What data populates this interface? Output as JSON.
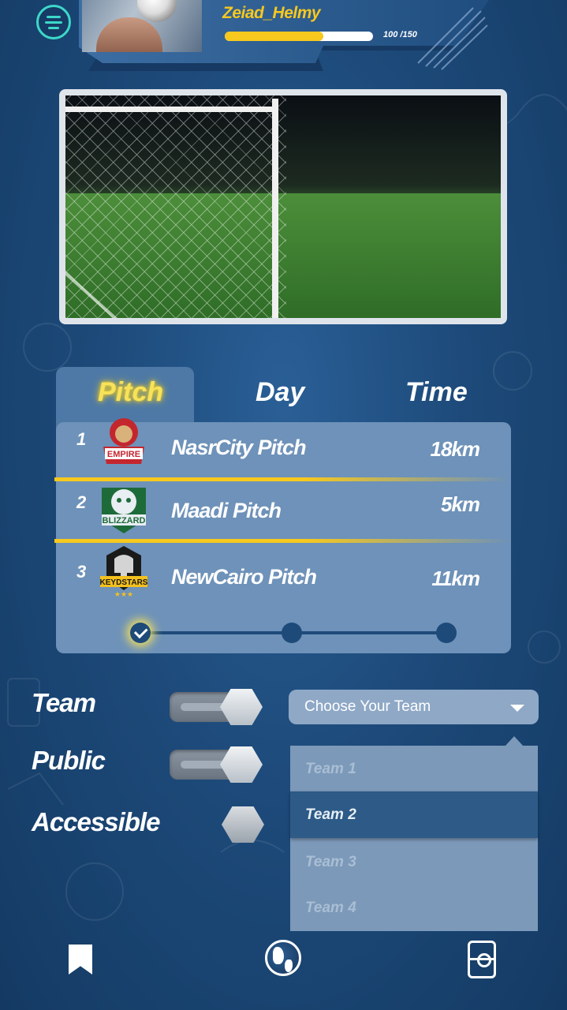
{
  "header": {
    "username": "Zeiad_Helmy",
    "xp_label": "100 /150",
    "xp_current": 100,
    "xp_max": 150
  },
  "tabs": [
    {
      "label": "Pitch",
      "active": true
    },
    {
      "label": "Day",
      "active": false
    },
    {
      "label": "Time",
      "active": false
    }
  ],
  "pitches": [
    {
      "rank": "1",
      "name": "NasrCity Pitch",
      "distance": "18km",
      "team_logo": "team-empire-logo"
    },
    {
      "rank": "2",
      "name": "Maadi Pitch",
      "distance": "5km",
      "team_logo": "blizzard-logo"
    },
    {
      "rank": "3",
      "name": "NewCairo Pitch",
      "distance": "11km",
      "team_logo": "keyd-stars-logo"
    }
  ],
  "stepper": {
    "steps": 3,
    "current": 1
  },
  "options": [
    {
      "label": "Team",
      "enabled": true
    },
    {
      "label": "Public",
      "enabled": true
    },
    {
      "label": "Accessible",
      "enabled": false
    }
  ],
  "team_select": {
    "placeholder": "Choose Your Team",
    "options": [
      "Team 1",
      "Team 2",
      "Team 3",
      "Team 4"
    ],
    "highlighted": "Team 2"
  },
  "bottom_nav": [
    "bookmark-icon",
    "globe-icon",
    "pitch-icon"
  ],
  "colors": {
    "accent": "#f7c81e",
    "teal": "#3dd8c9",
    "panel": "#6e92b9",
    "selected": "#2d5a86"
  }
}
